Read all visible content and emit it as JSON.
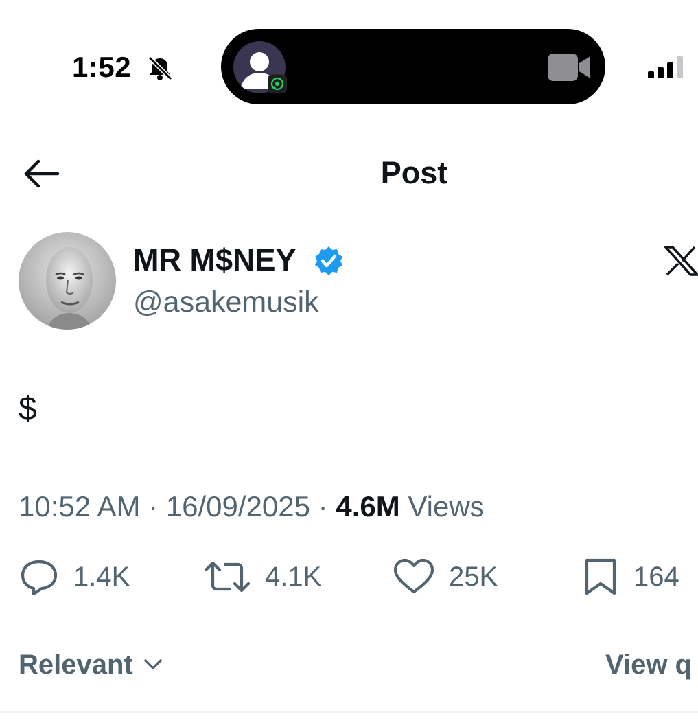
{
  "status_bar": {
    "time": "1:52",
    "icons": [
      "bell-slash-icon",
      "whatsapp-icon",
      "video-camera-icon",
      "signal-icon"
    ]
  },
  "header": {
    "back_icon": "arrow-left-icon",
    "title": "Post"
  },
  "author": {
    "display_name": "MR M$NEY",
    "handle": "@asakemusik",
    "verified_icon": "verified-badge-icon",
    "verified_color": "#1d9bf0",
    "grok_icon": "x-logo-icon"
  },
  "post": {
    "text": "$",
    "time": "10:52 AM",
    "sep1": " · ",
    "date": "16/09/2025",
    "sep2": " · ",
    "views_count": "4.6M",
    "views_label": " Views"
  },
  "actions": {
    "reply_count": "1.4K",
    "repost_count": "4.1K",
    "like_count": "25K",
    "bookmark_count": "164"
  },
  "replies_bar": {
    "sort_label": "Relevant",
    "view_quotes_label": "View q"
  },
  "colors": {
    "text_primary": "#0f1419",
    "text_secondary": "#536471",
    "accent": "#1d9bf0"
  }
}
